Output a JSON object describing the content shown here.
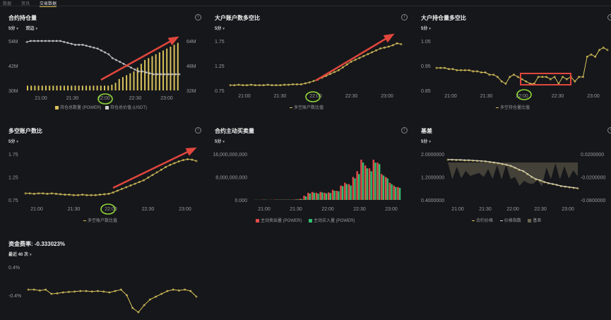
{
  "tabs": [
    "数据",
    "资讯",
    "交易数据"
  ],
  "colors": {
    "gold": "#d8c25a",
    "line_white": "#cfcfcf",
    "red": "#e24a4a",
    "green": "#2fbf71",
    "annot_red": "#e0463c",
    "annot_green": "#8fd43a",
    "grid": "#2a2b30"
  },
  "panels": {
    "open_interest": {
      "title": "合约持仓量",
      "interval": "5分",
      "mode": "双边",
      "legend": [
        "持仓总数量 (POWER)",
        "持仓总价值 (USDT)"
      ],
      "left_ticks": [
        "54M",
        "42M",
        "30M"
      ],
      "right_ticks": [
        "64M",
        "48M",
        "32M"
      ]
    },
    "top_accounts": {
      "title": "大户账户数多空比",
      "interval": "5分",
      "legend": "多空账户数比值",
      "ticks": [
        "1.75",
        "1.25",
        "0.75"
      ]
    },
    "top_positions": {
      "title": "大户持仓量多空比",
      "interval": "5分",
      "legend": "多空持仓量比值",
      "ticks": [
        "1.05",
        "0.95",
        "0.85"
      ]
    },
    "long_short": {
      "title": "多空账户数比",
      "interval": "5分",
      "legend": "多空账户数比值",
      "ticks": [
        "1.75",
        "1.25",
        "0.75"
      ]
    },
    "taker": {
      "title": "合约主动买卖量",
      "interval": "5分",
      "legend": [
        "主动卖出量 (POWER)",
        "主动买入量 (POWER)"
      ],
      "ticks": [
        "16,000,000,000",
        "8,000,000,000",
        "0.000"
      ]
    },
    "basis": {
      "title": "基差",
      "interval": "5分",
      "legend": [
        "合约价格",
        "价格指数",
        "基差"
      ],
      "left_ticks": [
        "2.0000000",
        "1.2000000",
        "0.4000000"
      ],
      "right_ticks": [
        "0.0200000",
        "-0.0200000",
        "-0.0800000"
      ]
    },
    "funding": {
      "title": "资金费率: -0.333023%",
      "interval": "最近 40 次",
      "ticks": [
        "0.4%",
        "-0.4%"
      ]
    }
  },
  "time_ticks": [
    "21:00",
    "21:30",
    "22:00",
    "22:30",
    "23:00"
  ],
  "chart_data": [
    {
      "type": "bar",
      "title": "合约持仓量",
      "series": [
        {
          "name": "持仓总数量 (POWER)",
          "type": "bar",
          "values": [
            32.5,
            32.5,
            32.5,
            32.5,
            32.5,
            32.5,
            32.5,
            32.5,
            32.5,
            32.5,
            32.5,
            32.5,
            32.5,
            32.5,
            32.5,
            32.5,
            32.5,
            32.5,
            32.5,
            32.5,
            32.5,
            32.5,
            32.5,
            33,
            34,
            36,
            37,
            38,
            39,
            40,
            42,
            44,
            46,
            47,
            48,
            49,
            50,
            51,
            52,
            53,
            54,
            55
          ]
        },
        {
          "name": "持仓总价值 (USDT)",
          "type": "line",
          "values": [
            55.5,
            56,
            56,
            56,
            56,
            56,
            56,
            56,
            56,
            56,
            55.5,
            55,
            54.5,
            54,
            54,
            54,
            53.5,
            53,
            52.5,
            52,
            51,
            50,
            49,
            47,
            46,
            45,
            44,
            43,
            42,
            41,
            40,
            40,
            39.5,
            39,
            38.5,
            38.5,
            38.5,
            38.5,
            38.5,
            38.5,
            38.5,
            38.5
          ]
        }
      ],
      "ylim_left": [
        30,
        56
      ],
      "ylim_right": [
        32,
        64
      ]
    },
    {
      "type": "line",
      "title": "大户账户数多空比",
      "series": [
        {
          "name": "多空账户数比值",
          "values": [
            0.86,
            0.86,
            0.87,
            0.86,
            0.86,
            0.87,
            0.86,
            0.86,
            0.86,
            0.87,
            0.86,
            0.86,
            0.86,
            0.87,
            0.87,
            0.88,
            0.88,
            0.88,
            0.9,
            0.92,
            0.95,
            0.98,
            1.02,
            1.06,
            1.1,
            1.14,
            1.18,
            1.24,
            1.3,
            1.36,
            1.4,
            1.44,
            1.48,
            1.52,
            1.56,
            1.6,
            1.64,
            1.66,
            1.68,
            1.71,
            1.75,
            1.73
          ]
        }
      ],
      "ylim": [
        0.75,
        1.8
      ]
    },
    {
      "type": "line",
      "title": "大户持仓量多空比",
      "series": [
        {
          "name": "多空持仓量比值",
          "values": [
            0.94,
            0.94,
            0.94,
            0.935,
            0.935,
            0.93,
            0.93,
            0.93,
            0.93,
            0.925,
            0.925,
            0.92,
            0.92,
            0.91,
            0.91,
            0.9,
            0.88,
            0.87,
            0.9,
            0.91,
            0.9,
            0.89,
            0.88,
            0.87,
            0.87,
            0.9,
            0.9,
            0.9,
            0.89,
            0.9,
            0.87,
            0.9,
            0.89,
            0.9,
            0.88,
            0.9,
            0.9,
            0.99,
            1.0,
            0.99,
            1.02,
            1.03,
            1.02
          ]
        }
      ],
      "ylim": [
        0.84,
        1.06
      ]
    },
    {
      "type": "line",
      "title": "多空账户数比",
      "series": [
        {
          "name": "多空账户数比值",
          "values": [
            0.9,
            0.9,
            0.89,
            0.9,
            0.9,
            0.89,
            0.9,
            0.89,
            0.88,
            0.87,
            0.87,
            0.86,
            0.86,
            0.87,
            0.86,
            0.86,
            0.86,
            0.87,
            0.88,
            0.89,
            0.92,
            0.96,
            1.0,
            1.04,
            1.08,
            1.12,
            1.16,
            1.2,
            1.26,
            1.32,
            1.38,
            1.44,
            1.5,
            1.55,
            1.59,
            1.63,
            1.66,
            1.68,
            1.67,
            1.64
          ]
        }
      ],
      "ylim": [
        0.75,
        1.8
      ]
    },
    {
      "type": "bar",
      "title": "合约主动买卖量",
      "categories_count": 36,
      "series": [
        {
          "name": "主动卖出量 (POWER)",
          "values": [
            0.05,
            0.05,
            0.1,
            0.05,
            0.05,
            0.1,
            0.1,
            0.1,
            0.1,
            0.1,
            0.2,
            0.4,
            1.5,
            2.5,
            2.8,
            2.5,
            2.8,
            2.5,
            2.6,
            3.5,
            3.2,
            5,
            6,
            5.5,
            8,
            10,
            14,
            12,
            11,
            14,
            13,
            9,
            8,
            6,
            5,
            4.5
          ]
        },
        {
          "name": "主动买入量 (POWER)",
          "values": [
            0.05,
            0.05,
            0.1,
            0.05,
            0.05,
            0.1,
            0.1,
            0.1,
            0.1,
            0.1,
            0.2,
            0.3,
            1.2,
            2.2,
            2.5,
            2.2,
            2.6,
            2.3,
            2.4,
            3.2,
            3,
            4.8,
            5.5,
            5,
            7.5,
            9,
            13,
            11,
            10,
            13,
            12.5,
            8.5,
            7.5,
            5.5,
            4.5,
            4.2
          ]
        }
      ],
      "ylim": [
        0,
        16
      ],
      "unit": "1,000,000,000"
    },
    {
      "type": "line",
      "title": "基差",
      "series": [
        {
          "name": "合约价格",
          "values": [
            1.8,
            1.8,
            1.79,
            1.79,
            1.78,
            1.78,
            1.77,
            1.76,
            1.75,
            1.74,
            1.72,
            1.7,
            1.68,
            1.65,
            1.62,
            1.58,
            1.52,
            1.45,
            1.4,
            1.3,
            1.2,
            1.12,
            1.08,
            1.02,
            0.98,
            0.95,
            0.92,
            0.88,
            0.86,
            0.84,
            0.82,
            0.8
          ]
        },
        {
          "name": "价格指数",
          "values": [
            1.81,
            1.81,
            1.8,
            1.8,
            1.79,
            1.79,
            1.78,
            1.77,
            1.76,
            1.75,
            1.73,
            1.71,
            1.69,
            1.66,
            1.63,
            1.59,
            1.53,
            1.46,
            1.41,
            1.31,
            1.21,
            1.13,
            1.09,
            1.03,
            0.99,
            0.96,
            0.93,
            0.89,
            0.87,
            0.85,
            0.83,
            0.81
          ]
        }
      ],
      "ylim": [
        0.4,
        2.0
      ]
    },
    {
      "type": "line",
      "title": "资金费率: -0.333023%",
      "series": [
        {
          "name": "资金费率",
          "values": [
            -0.05,
            -0.05,
            -0.08,
            -0.05,
            -0.2,
            -0.18,
            -0.15,
            -0.13,
            -0.12,
            -0.1,
            -0.1,
            -0.12,
            -0.1,
            -0.12,
            -0.15,
            -0.1,
            -0.05,
            -0.25,
            -0.7,
            -0.85,
            -0.6,
            -0.4,
            -0.3,
            -0.2,
            -0.1,
            -0.05,
            -0.08,
            -0.05,
            -0.1,
            -0.3
          ]
        }
      ],
      "ylim": [
        -1.0,
        0.5
      ]
    }
  ]
}
